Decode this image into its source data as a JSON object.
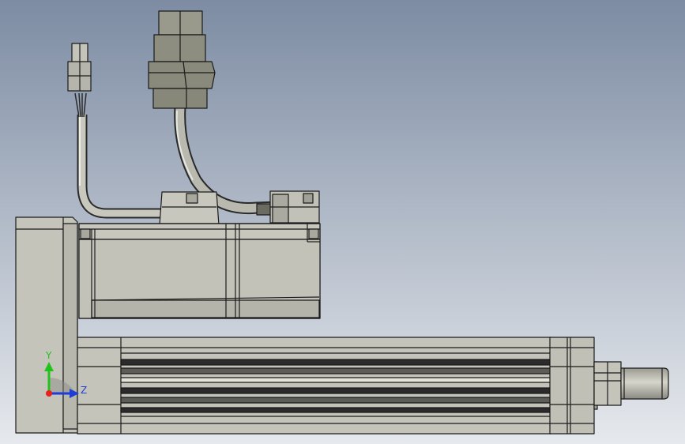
{
  "viewport": {
    "background_top": "#7d8ca3",
    "background_bottom": "#e6e9ed",
    "part_fill": "#c4c4bb",
    "part_shade": "#a8a89f",
    "part_dark": "#8f8f86",
    "edge_color": "#1a1a1a",
    "connector_fill": "#9a9a8c"
  },
  "triad": {
    "y_label": "Y",
    "z_label": "Z",
    "y_color": "#21c21a",
    "z_color": "#1e3cd6",
    "x_color": "#e8221a"
  }
}
